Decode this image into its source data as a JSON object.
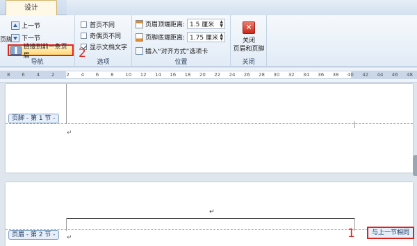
{
  "ribbon": {
    "active_tab": "设计",
    "partial_label": "页脚",
    "nav": {
      "prev_section": "上一节",
      "next_section": "下一节",
      "link_to_previous": "链接到前一条页眉",
      "group_label": "导航"
    },
    "options": {
      "different_first_page": {
        "label": "首页不同",
        "checked": false
      },
      "different_odd_even": {
        "label": "奇偶页不同",
        "checked": false
      },
      "show_document_text": {
        "label": "显示文档文字",
        "checked": true
      },
      "group_label": "选项"
    },
    "position": {
      "header_from_top_label": "页眉顶端距离:",
      "header_from_top_value": "1.5 厘米",
      "footer_from_bottom_label": "页脚底端距离:",
      "footer_from_bottom_value": "1.75 厘米",
      "insert_alignment_tab": "插入“对齐方式”选项卡",
      "group_label": "位置"
    },
    "close": {
      "label_line1": "关闭",
      "label_line2": "页眉和页脚",
      "group_label": "关闭"
    }
  },
  "ruler": {
    "ticks": [
      "8",
      "6",
      "4",
      "2",
      "2",
      "4",
      "6",
      "8",
      "10",
      "12",
      "14",
      "16",
      "18",
      "20",
      "22",
      "24",
      "26",
      "28",
      "30",
      "32",
      "34",
      "36",
      "38",
      "40",
      "42",
      "44",
      "46",
      "48"
    ]
  },
  "document": {
    "footer_section1_tag": "页脚 - 第 1 节 -",
    "header_section2_tag": "页眉 - 第 2 节 -",
    "same_as_previous": "与上一节相同",
    "paragraph_mark": "↵"
  },
  "annotations": {
    "step1": "1",
    "step2": "2",
    "highlight_color": "#e0221d"
  }
}
